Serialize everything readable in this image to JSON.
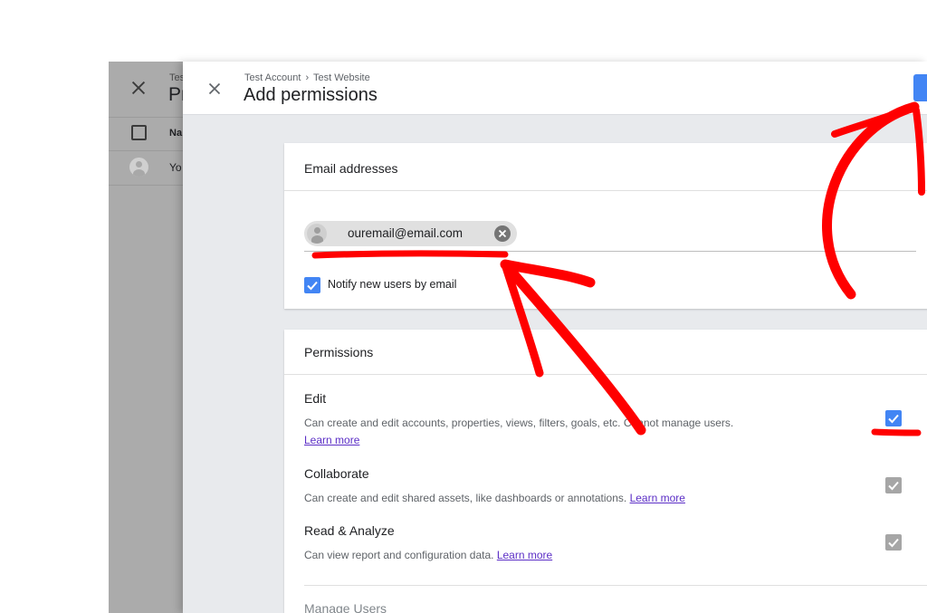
{
  "background_page": {
    "breadcrumb": "Tes",
    "title": "Pr",
    "column_header": "Na",
    "row_text": "Yo"
  },
  "panel": {
    "breadcrumb": {
      "account": "Test Account",
      "separator": "›",
      "property": "Test Website"
    },
    "title": "Add permissions",
    "accent_color": "#4285f4"
  },
  "emails": {
    "section_title": "Email addresses",
    "chip_email": "ouremail@email.com",
    "notify_label": "Notify new users by email",
    "notify_checked": true
  },
  "permissions": {
    "section_title": "Permissions",
    "items": [
      {
        "name": "Edit",
        "description": "Can create and edit accounts, properties, views, filters, goals, etc. Cannot manage users.",
        "learn_more": "Learn more",
        "checked": true,
        "checkbox_state": "checked"
      },
      {
        "name": "Collaborate",
        "description": "Can create and edit shared assets, like dashboards or annotations.",
        "learn_more": "Learn more",
        "checked": true,
        "checkbox_state": "checked-disabled"
      },
      {
        "name": "Read & Analyze",
        "description": "Can view report and configuration data.",
        "learn_more": "Learn more",
        "checked": true,
        "checkbox_state": "checked-disabled"
      },
      {
        "name": "Manage Users"
      }
    ]
  },
  "annotation": {
    "color": "#ff0000",
    "type": "hand-drawn red arrows and underlines"
  }
}
